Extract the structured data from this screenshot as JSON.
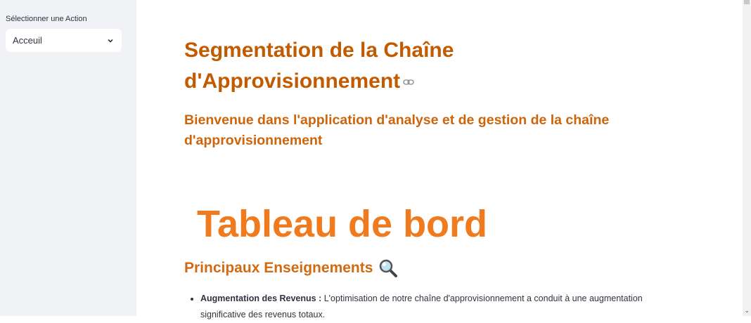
{
  "sidebar": {
    "select_label": "Sélectionner une Action",
    "select_value": "Acceuil"
  },
  "main": {
    "title": "Segmentation de la Chaîne d'Approvisionnement",
    "subtitle": "Bienvenue dans l'application d'analyse et de gestion de la chaîne d'approvisionnement",
    "banner": "Tableau de bord",
    "section_title": "Principaux Enseignements",
    "bullets": [
      {
        "bold": "Augmentation des Revenus :",
        "text": " L'optimisation de notre chaîne d'approvisionnement a conduit à une augmentation significative des revenus totaux."
      }
    ]
  },
  "colors": {
    "title": "#c25a00",
    "banner": "#f07a1e",
    "sidebar_bg": "#f0f2f6"
  }
}
